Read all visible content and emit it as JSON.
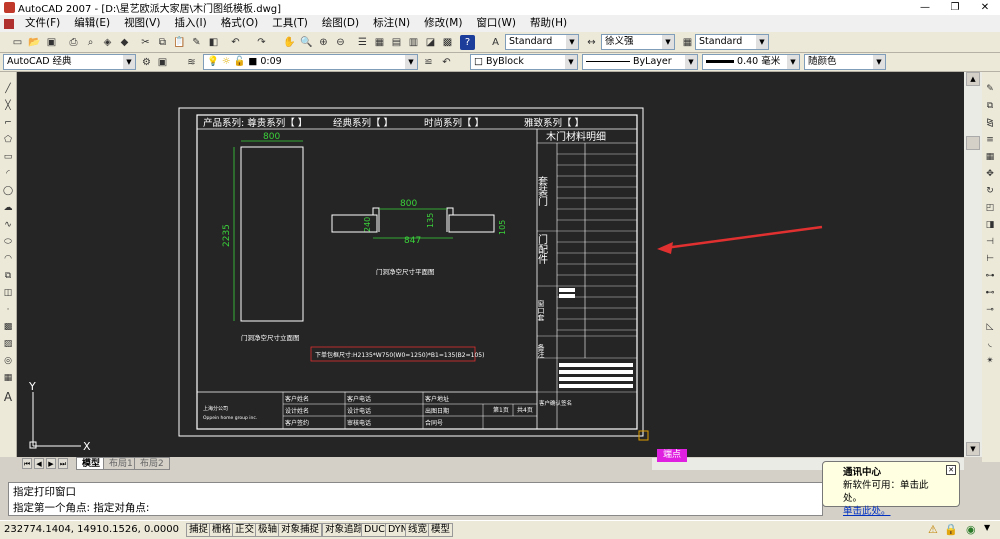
{
  "window": {
    "title": "AutoCAD 2007 - [D:\\星艺欧派大家居\\木门图纸模板.dwg]",
    "min": "—",
    "max": "❐",
    "close": "✕"
  },
  "menu": [
    "文件(F)",
    "编辑(E)",
    "视图(V)",
    "插入(I)",
    "格式(O)",
    "工具(T)",
    "绘图(D)",
    "标注(N)",
    "修改(M)",
    "窗口(W)",
    "帮助(H)"
  ],
  "toolbar1": {
    "text_style": "Standard",
    "dim_style": "徐义强",
    "table_style": "Standard"
  },
  "toolbar2": {
    "workspace": "AutoCAD 经典",
    "layer": "0:09",
    "color": "ByBlock",
    "linetype": "ByLayer",
    "lineweight": "0.40 毫米",
    "plotstyle": "随颜色"
  },
  "tabs": [
    "模型",
    "布局1",
    "布局2"
  ],
  "command": {
    "line1": "指定打印窗口",
    "line2": "指定第一个角点: 指定对角点:"
  },
  "status": {
    "coords": "232774.1404, 14910.1526, 0.0000",
    "buttons": [
      "捕捉",
      "栅格",
      "正交",
      "极轴",
      "对象捕捉",
      "对象追踪",
      "DUCS",
      "DYN",
      "线宽",
      "模型"
    ]
  },
  "popup": {
    "title": "通讯中心",
    "body": "新软件可用：单击此处。",
    "link": "单击此处。"
  },
  "snap_tip": "端点",
  "drawing": {
    "product_series": "产品系列: 尊贵系列【    】",
    "classic_series": "经典系列【    】",
    "fashion_series": "时尚系列【    】",
    "elegant_series": "雅致系列【    】",
    "right_title": "木门材料明细",
    "set_door": "套装门",
    "door_accessory": "门配件",
    "window_set": "窗口套",
    "notes": "备注",
    "order_dim": "下单包框尺寸:H2135*W750(W0=1250)*B1=135(B2=105)",
    "front_caption": "门洞净空尺寸立面图",
    "plan_caption": "门洞净空尺寸平面图",
    "dim_800a": "800",
    "dim_2235": "2235",
    "dim_800b": "800",
    "dim_847": "847",
    "dim_240": "240",
    "dim_135": "135",
    "dim_105": "105",
    "company": "上海分公司",
    "company_en": "Oppein home group inc.",
    "bottom_labels": [
      "客户姓名",
      "设计姓名",
      "客户签约",
      "客户电话",
      "设计电话",
      "审核电话",
      "客户地址",
      "出图日期",
      "合同号",
      "第1页",
      "共4页",
      "客户确认签名"
    ]
  },
  "colors": {
    "canvas": "#252525",
    "dims": "#3ad33a",
    "accent": "#e03030",
    "frame": "#ffffff"
  }
}
